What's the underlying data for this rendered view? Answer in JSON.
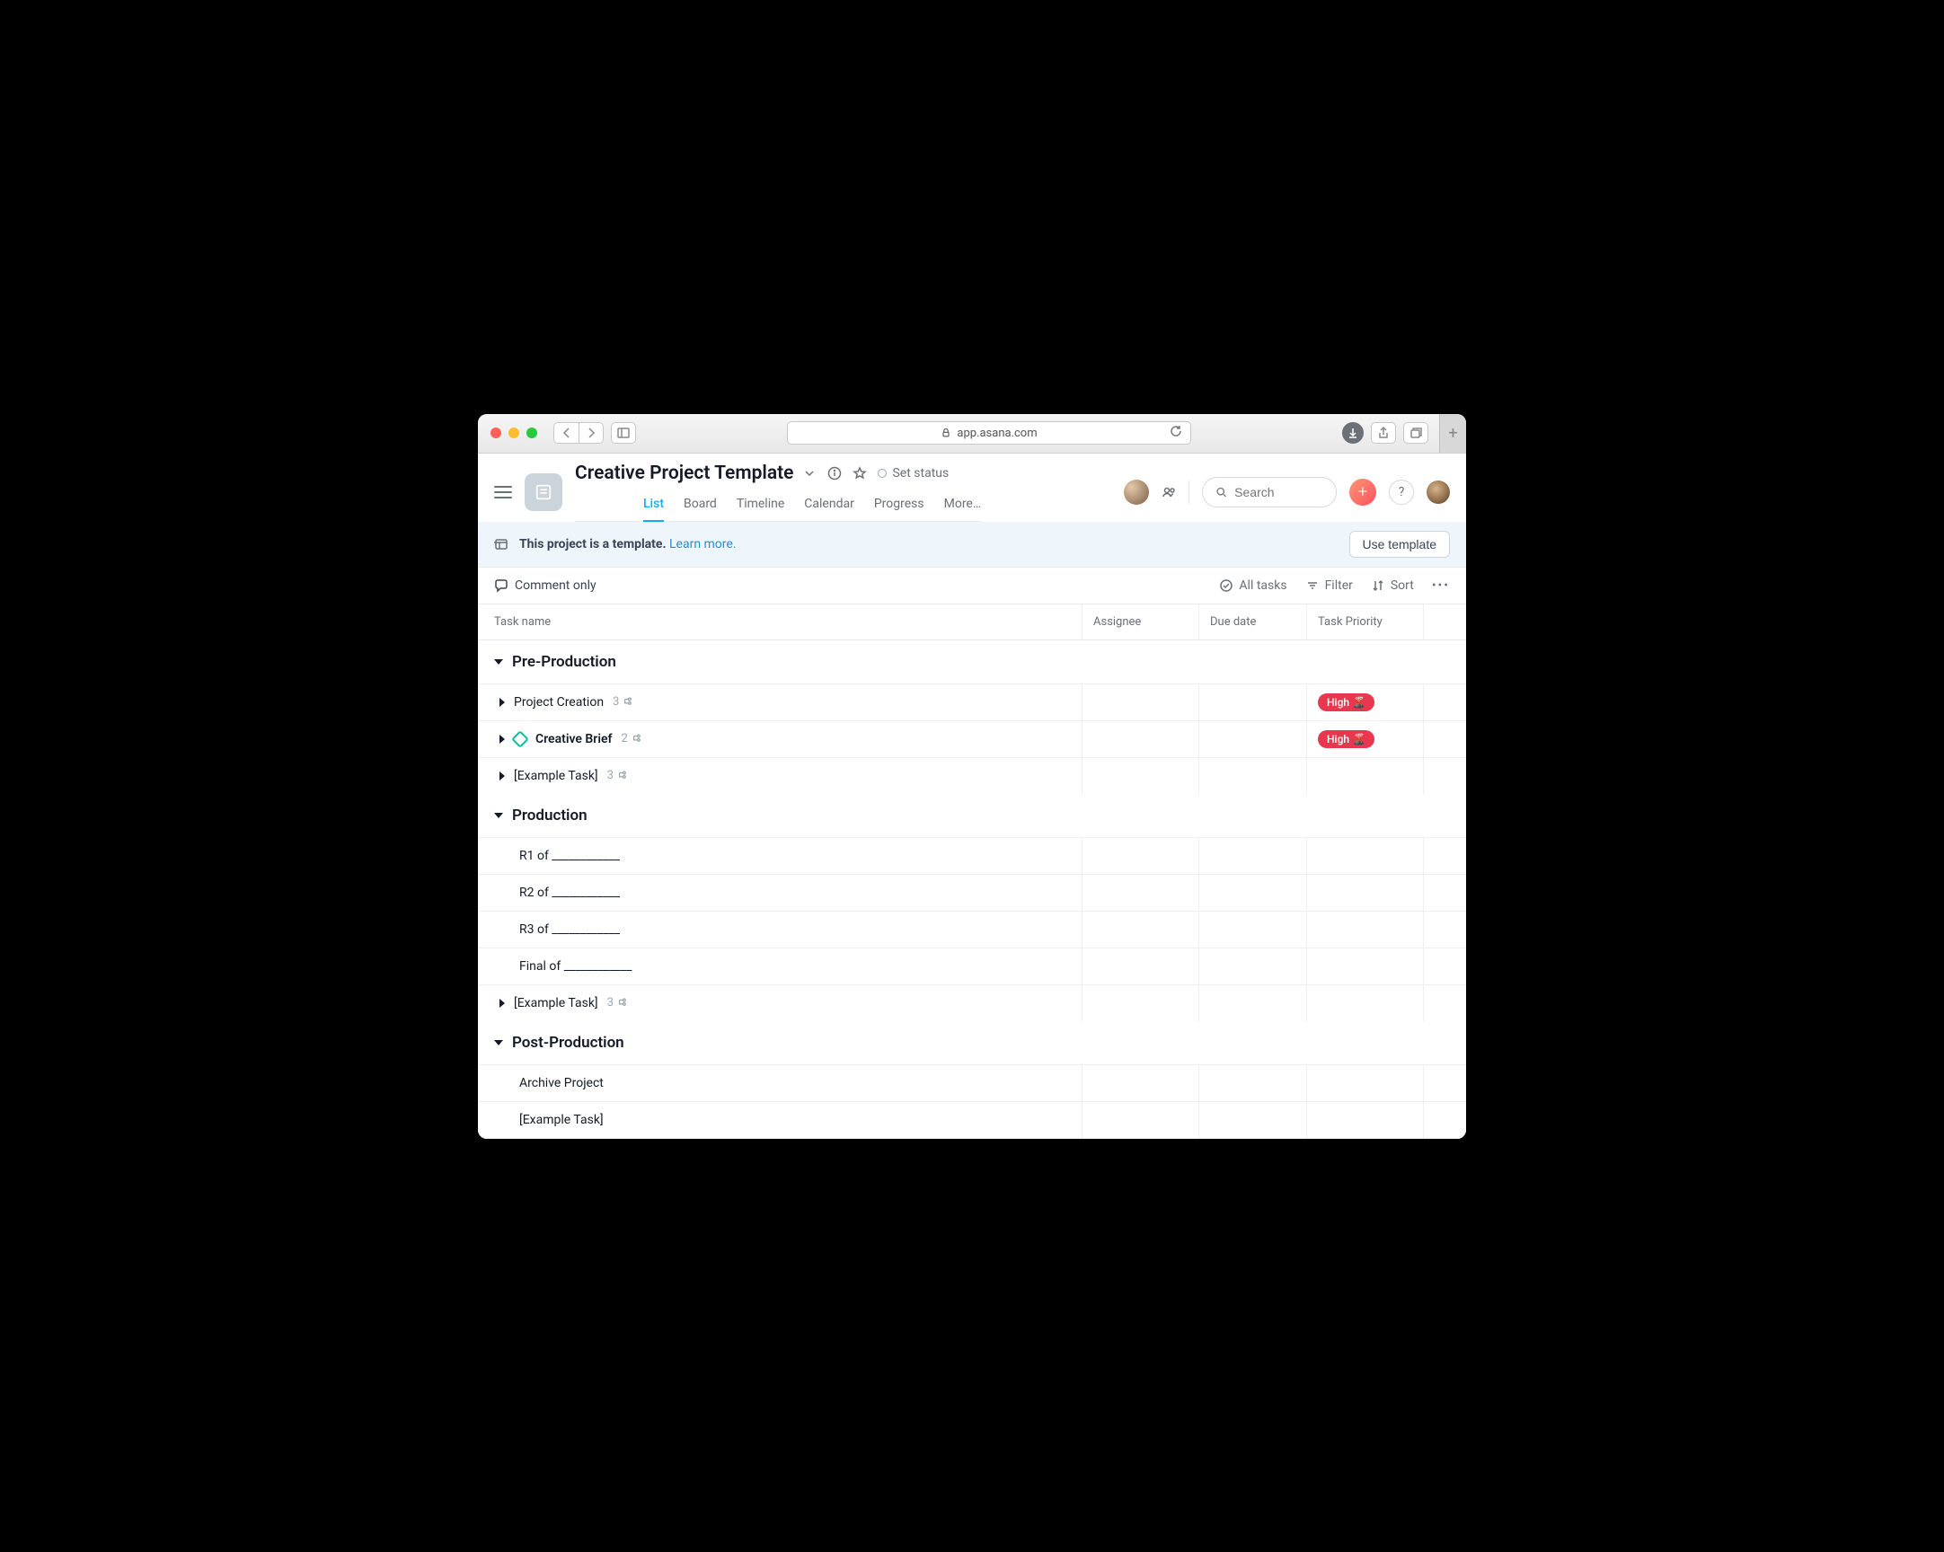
{
  "browser": {
    "url": "app.asana.com"
  },
  "project": {
    "title": "Creative Project Template",
    "set_status": "Set status"
  },
  "tabs": [
    "List",
    "Board",
    "Timeline",
    "Calendar",
    "Progress",
    "More…"
  ],
  "active_tab_index": 0,
  "search": {
    "placeholder": "Search"
  },
  "banner": {
    "text": "This project is a template.",
    "link": "Learn more.",
    "button": "Use template"
  },
  "toolbar": {
    "comment_only": "Comment only",
    "all_tasks": "All tasks",
    "filter": "Filter",
    "sort": "Sort"
  },
  "columns": {
    "task_name": "Task name",
    "assignee": "Assignee",
    "due_date": "Due date",
    "priority": "Task Priority"
  },
  "priority_labels": {
    "high": "High 🌋"
  },
  "sections": [
    {
      "title": "Pre-Production",
      "expanded": true,
      "tasks": [
        {
          "name": "Project Creation",
          "has_caret": true,
          "subtasks": 3,
          "priority": "high"
        },
        {
          "name": "Creative Brief",
          "has_caret": true,
          "milestone": true,
          "bold": true,
          "subtasks": 2,
          "priority": "high"
        },
        {
          "name": "[Example Task]",
          "has_caret": true,
          "subtasks": 3
        }
      ]
    },
    {
      "title": "Production",
      "expanded": true,
      "tasks": [
        {
          "name": "R1 of ____________"
        },
        {
          "name": "R2 of ____________"
        },
        {
          "name": "R3 of ____________"
        },
        {
          "name": "Final of ____________"
        },
        {
          "name": "[Example Task]",
          "has_caret": true,
          "subtasks": 3
        }
      ]
    },
    {
      "title": "Post-Production",
      "expanded": true,
      "tasks": [
        {
          "name": "Archive Project"
        },
        {
          "name": "[Example Task]"
        }
      ]
    }
  ]
}
